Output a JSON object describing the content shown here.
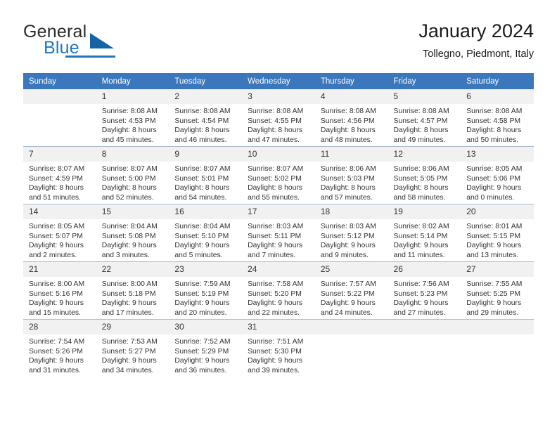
{
  "brand": {
    "name_top": "General",
    "name_bottom": "Blue",
    "accent_color": "#1f77c2",
    "triangle_color": "#1464a5"
  },
  "header": {
    "month_title": "January 2024",
    "location": "Tollegno, Piedmont, Italy"
  },
  "calendar": {
    "header_bg": "#3b77bc",
    "daynum_bg": "#f1f1f1",
    "weekday_headers": [
      "Sunday",
      "Monday",
      "Tuesday",
      "Wednesday",
      "Thursday",
      "Friday",
      "Saturday"
    ],
    "weeks": [
      [
        {
          "day": "",
          "empty": true,
          "sunrise": "",
          "sunset": "",
          "daylight_1": "",
          "daylight_2": ""
        },
        {
          "day": "1",
          "sunrise": "Sunrise: 8:08 AM",
          "sunset": "Sunset: 4:53 PM",
          "daylight_1": "Daylight: 8 hours",
          "daylight_2": "and 45 minutes."
        },
        {
          "day": "2",
          "sunrise": "Sunrise: 8:08 AM",
          "sunset": "Sunset: 4:54 PM",
          "daylight_1": "Daylight: 8 hours",
          "daylight_2": "and 46 minutes."
        },
        {
          "day": "3",
          "sunrise": "Sunrise: 8:08 AM",
          "sunset": "Sunset: 4:55 PM",
          "daylight_1": "Daylight: 8 hours",
          "daylight_2": "and 47 minutes."
        },
        {
          "day": "4",
          "sunrise": "Sunrise: 8:08 AM",
          "sunset": "Sunset: 4:56 PM",
          "daylight_1": "Daylight: 8 hours",
          "daylight_2": "and 48 minutes."
        },
        {
          "day": "5",
          "sunrise": "Sunrise: 8:08 AM",
          "sunset": "Sunset: 4:57 PM",
          "daylight_1": "Daylight: 8 hours",
          "daylight_2": "and 49 minutes."
        },
        {
          "day": "6",
          "sunrise": "Sunrise: 8:08 AM",
          "sunset": "Sunset: 4:58 PM",
          "daylight_1": "Daylight: 8 hours",
          "daylight_2": "and 50 minutes."
        }
      ],
      [
        {
          "day": "7",
          "sunrise": "Sunrise: 8:07 AM",
          "sunset": "Sunset: 4:59 PM",
          "daylight_1": "Daylight: 8 hours",
          "daylight_2": "and 51 minutes."
        },
        {
          "day": "8",
          "sunrise": "Sunrise: 8:07 AM",
          "sunset": "Sunset: 5:00 PM",
          "daylight_1": "Daylight: 8 hours",
          "daylight_2": "and 52 minutes."
        },
        {
          "day": "9",
          "sunrise": "Sunrise: 8:07 AM",
          "sunset": "Sunset: 5:01 PM",
          "daylight_1": "Daylight: 8 hours",
          "daylight_2": "and 54 minutes."
        },
        {
          "day": "10",
          "sunrise": "Sunrise: 8:07 AM",
          "sunset": "Sunset: 5:02 PM",
          "daylight_1": "Daylight: 8 hours",
          "daylight_2": "and 55 minutes."
        },
        {
          "day": "11",
          "sunrise": "Sunrise: 8:06 AM",
          "sunset": "Sunset: 5:03 PM",
          "daylight_1": "Daylight: 8 hours",
          "daylight_2": "and 57 minutes."
        },
        {
          "day": "12",
          "sunrise": "Sunrise: 8:06 AM",
          "sunset": "Sunset: 5:05 PM",
          "daylight_1": "Daylight: 8 hours",
          "daylight_2": "and 58 minutes."
        },
        {
          "day": "13",
          "sunrise": "Sunrise: 8:05 AM",
          "sunset": "Sunset: 5:06 PM",
          "daylight_1": "Daylight: 9 hours",
          "daylight_2": "and 0 minutes."
        }
      ],
      [
        {
          "day": "14",
          "sunrise": "Sunrise: 8:05 AM",
          "sunset": "Sunset: 5:07 PM",
          "daylight_1": "Daylight: 9 hours",
          "daylight_2": "and 2 minutes."
        },
        {
          "day": "15",
          "sunrise": "Sunrise: 8:04 AM",
          "sunset": "Sunset: 5:08 PM",
          "daylight_1": "Daylight: 9 hours",
          "daylight_2": "and 3 minutes."
        },
        {
          "day": "16",
          "sunrise": "Sunrise: 8:04 AM",
          "sunset": "Sunset: 5:10 PM",
          "daylight_1": "Daylight: 9 hours",
          "daylight_2": "and 5 minutes."
        },
        {
          "day": "17",
          "sunrise": "Sunrise: 8:03 AM",
          "sunset": "Sunset: 5:11 PM",
          "daylight_1": "Daylight: 9 hours",
          "daylight_2": "and 7 minutes."
        },
        {
          "day": "18",
          "sunrise": "Sunrise: 8:03 AM",
          "sunset": "Sunset: 5:12 PM",
          "daylight_1": "Daylight: 9 hours",
          "daylight_2": "and 9 minutes."
        },
        {
          "day": "19",
          "sunrise": "Sunrise: 8:02 AM",
          "sunset": "Sunset: 5:14 PM",
          "daylight_1": "Daylight: 9 hours",
          "daylight_2": "and 11 minutes."
        },
        {
          "day": "20",
          "sunrise": "Sunrise: 8:01 AM",
          "sunset": "Sunset: 5:15 PM",
          "daylight_1": "Daylight: 9 hours",
          "daylight_2": "and 13 minutes."
        }
      ],
      [
        {
          "day": "21",
          "sunrise": "Sunrise: 8:00 AM",
          "sunset": "Sunset: 5:16 PM",
          "daylight_1": "Daylight: 9 hours",
          "daylight_2": "and 15 minutes."
        },
        {
          "day": "22",
          "sunrise": "Sunrise: 8:00 AM",
          "sunset": "Sunset: 5:18 PM",
          "daylight_1": "Daylight: 9 hours",
          "daylight_2": "and 17 minutes."
        },
        {
          "day": "23",
          "sunrise": "Sunrise: 7:59 AM",
          "sunset": "Sunset: 5:19 PM",
          "daylight_1": "Daylight: 9 hours",
          "daylight_2": "and 20 minutes."
        },
        {
          "day": "24",
          "sunrise": "Sunrise: 7:58 AM",
          "sunset": "Sunset: 5:20 PM",
          "daylight_1": "Daylight: 9 hours",
          "daylight_2": "and 22 minutes."
        },
        {
          "day": "25",
          "sunrise": "Sunrise: 7:57 AM",
          "sunset": "Sunset: 5:22 PM",
          "daylight_1": "Daylight: 9 hours",
          "daylight_2": "and 24 minutes."
        },
        {
          "day": "26",
          "sunrise": "Sunrise: 7:56 AM",
          "sunset": "Sunset: 5:23 PM",
          "daylight_1": "Daylight: 9 hours",
          "daylight_2": "and 27 minutes."
        },
        {
          "day": "27",
          "sunrise": "Sunrise: 7:55 AM",
          "sunset": "Sunset: 5:25 PM",
          "daylight_1": "Daylight: 9 hours",
          "daylight_2": "and 29 minutes."
        }
      ],
      [
        {
          "day": "28",
          "sunrise": "Sunrise: 7:54 AM",
          "sunset": "Sunset: 5:26 PM",
          "daylight_1": "Daylight: 9 hours",
          "daylight_2": "and 31 minutes."
        },
        {
          "day": "29",
          "sunrise": "Sunrise: 7:53 AM",
          "sunset": "Sunset: 5:27 PM",
          "daylight_1": "Daylight: 9 hours",
          "daylight_2": "and 34 minutes."
        },
        {
          "day": "30",
          "sunrise": "Sunrise: 7:52 AM",
          "sunset": "Sunset: 5:29 PM",
          "daylight_1": "Daylight: 9 hours",
          "daylight_2": "and 36 minutes."
        },
        {
          "day": "31",
          "sunrise": "Sunrise: 7:51 AM",
          "sunset": "Sunset: 5:30 PM",
          "daylight_1": "Daylight: 9 hours",
          "daylight_2": "and 39 minutes."
        },
        {
          "day": "",
          "empty": true,
          "sunrise": "",
          "sunset": "",
          "daylight_1": "",
          "daylight_2": ""
        },
        {
          "day": "",
          "empty": true,
          "sunrise": "",
          "sunset": "",
          "daylight_1": "",
          "daylight_2": ""
        },
        {
          "day": "",
          "empty": true,
          "sunrise": "",
          "sunset": "",
          "daylight_1": "",
          "daylight_2": ""
        }
      ]
    ]
  }
}
